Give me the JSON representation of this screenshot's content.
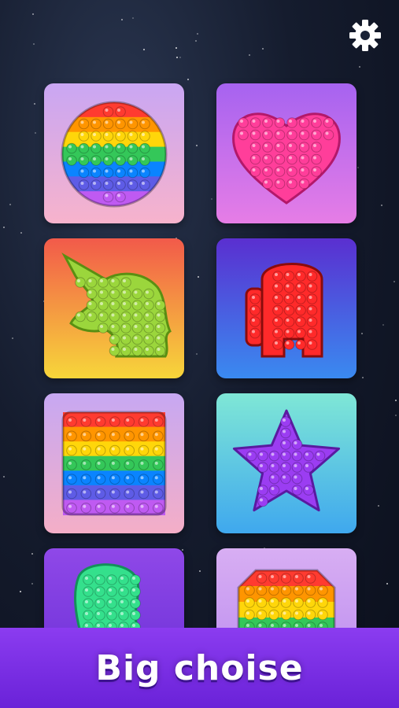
{
  "banner": {
    "text": "Big choise"
  },
  "settings": {
    "icon": "gear-icon"
  },
  "tiles": [
    {
      "name": "tile-circle",
      "shape": "rainbow-circle",
      "bg": [
        "#c9a6f3",
        "#f7b3cc"
      ]
    },
    {
      "name": "tile-heart",
      "shape": "pink-heart",
      "bg": [
        "#a663f0",
        "#e67de6"
      ]
    },
    {
      "name": "tile-unicorn",
      "shape": "green-unicorn",
      "bg": [
        "#f25a4a",
        "#f7d63a"
      ]
    },
    {
      "name": "tile-crewmate",
      "shape": "red-crewmate",
      "bg": [
        "#5a2fd0",
        "#3a8af0"
      ]
    },
    {
      "name": "tile-square",
      "shape": "rainbow-square",
      "bg": [
        "#c7a8f2",
        "#f4aec7"
      ]
    },
    {
      "name": "tile-star",
      "shape": "purple-star",
      "bg": [
        "#7fe7d6",
        "#3fa8ee"
      ]
    },
    {
      "name": "tile-foot",
      "shape": "green-foot",
      "bg": [
        "#8f48e8",
        "#6a2fd6"
      ]
    },
    {
      "name": "tile-octagon",
      "shape": "rainbow-octagon",
      "bg": [
        "#d8aef3",
        "#b98aef"
      ]
    }
  ],
  "palette": {
    "rainbow": [
      "#ff3b30",
      "#ff9500",
      "#ffd60a",
      "#34c759",
      "#0a84ff",
      "#5e5ce6",
      "#bf5af2"
    ],
    "pink": "#ff3e9a",
    "green": "#9bd63c",
    "red": "#ff2a2a",
    "purple": "#9b3df2",
    "mint": "#34e08c"
  }
}
